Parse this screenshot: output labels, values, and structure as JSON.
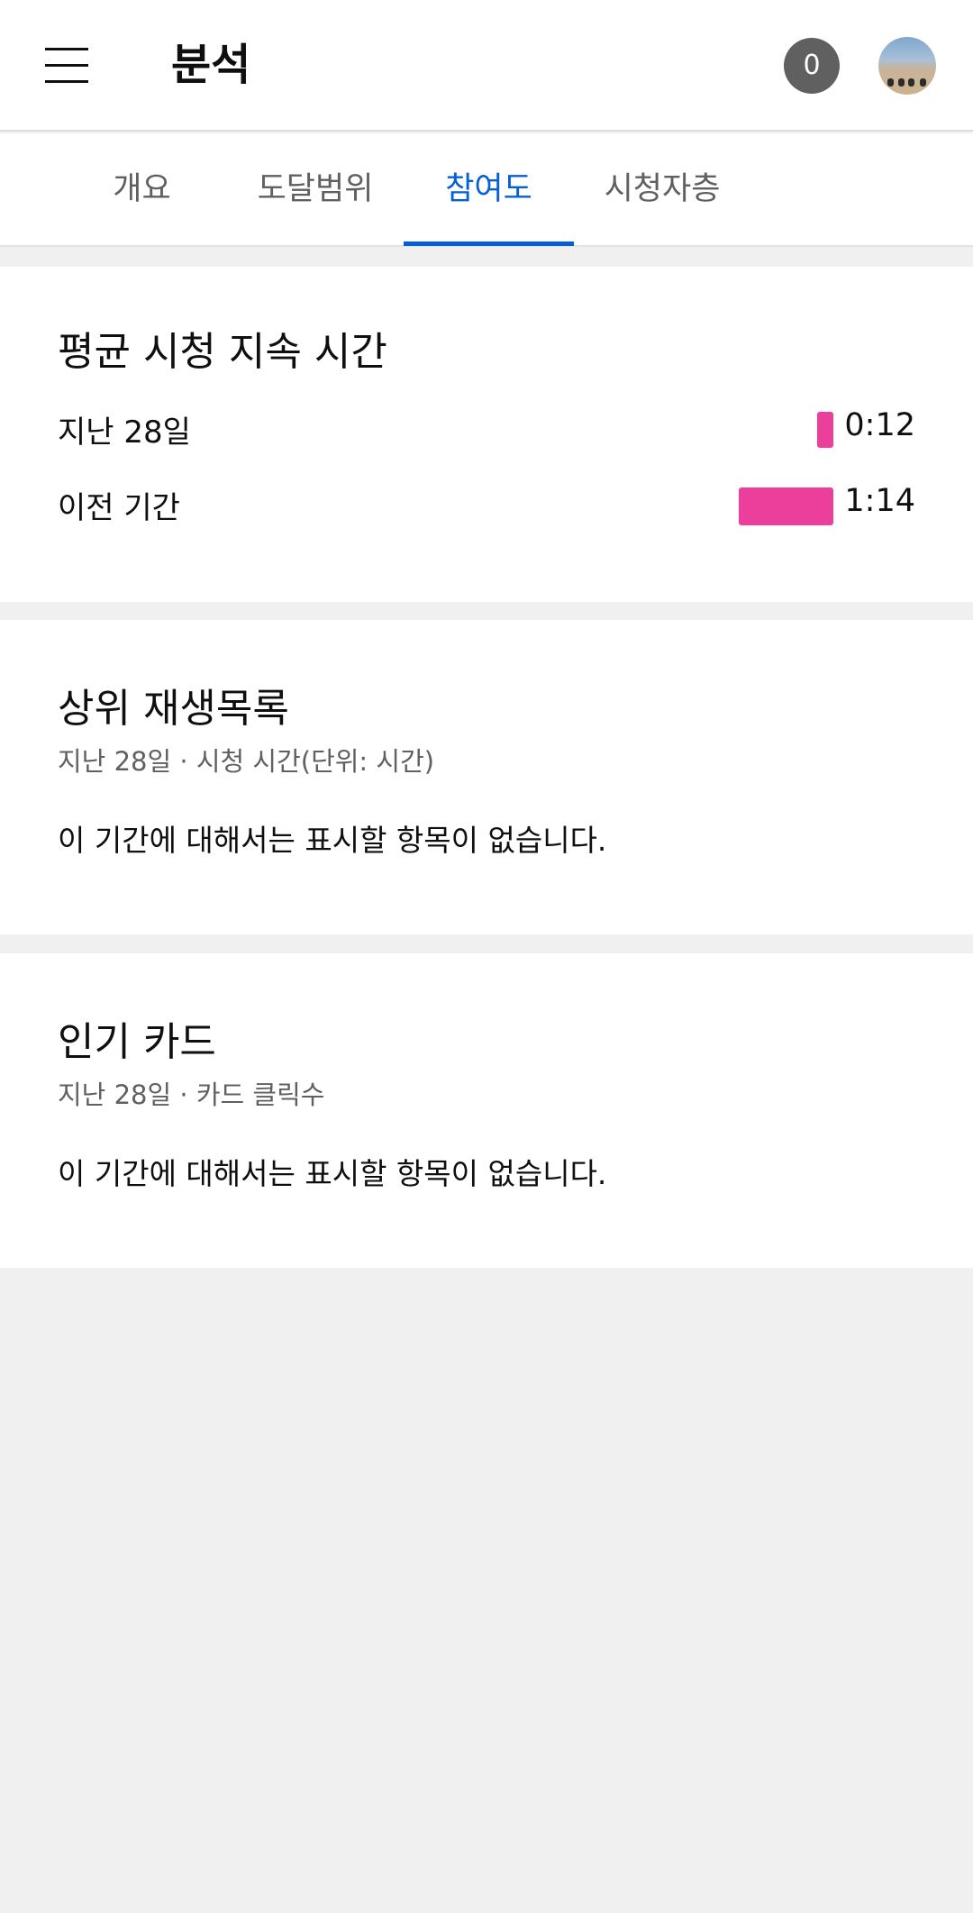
{
  "header": {
    "title": "분석",
    "notification_count": "0"
  },
  "tabs": [
    {
      "label": "개요"
    },
    {
      "label": "도달범위"
    },
    {
      "label": "참여도"
    },
    {
      "label": "시청자층"
    }
  ],
  "active_tab": "참여도",
  "avg_view_duration": {
    "title": "평균 시청 지속 시간",
    "rows": [
      {
        "label": "지난 28일",
        "value": "0:12"
      },
      {
        "label": "이전 기간",
        "value": "1:14"
      }
    ],
    "bar_color": "#ec3f9c"
  },
  "chart_data": {
    "type": "bar",
    "title": "평균 시청 지속 시간",
    "categories": [
      "지난 28일",
      "이전 기간"
    ],
    "values_seconds": [
      12,
      74
    ],
    "value_labels": [
      "0:12",
      "1:14"
    ]
  },
  "top_playlists": {
    "title": "상위 재생목록",
    "subtitle": "지난 28일 · 시청 시간(단위: 시간)",
    "empty_message": "이 기간에 대해서는 표시할 항목이 없습니다."
  },
  "top_cards": {
    "title": "인기 카드",
    "subtitle": "지난 28일 · 카드 클릭수",
    "empty_message": "이 기간에 대해서는 표시할 항목이 없습니다."
  },
  "colors": {
    "accent": "#065fd4",
    "background": "#f0f0f0"
  }
}
